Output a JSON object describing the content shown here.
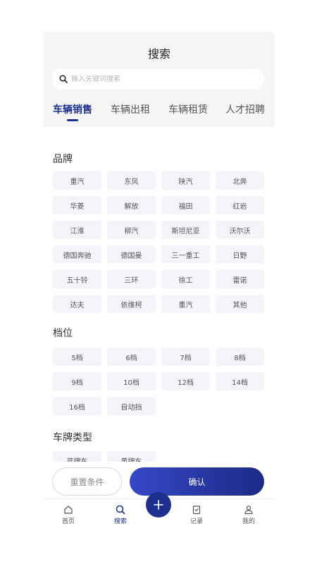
{
  "header": {
    "title": "搜索"
  },
  "search": {
    "placeholder": "输入关键词搜索"
  },
  "tabs": [
    {
      "label": "车辆销售",
      "active": true
    },
    {
      "label": "车辆出租",
      "active": false
    },
    {
      "label": "车辆租赁",
      "active": false
    },
    {
      "label": "人才招聘",
      "active": false
    }
  ],
  "sections": {
    "brand": {
      "title": "品牌",
      "options": [
        "重汽",
        "东风",
        "陕汽",
        "北奔",
        "华菱",
        "解放",
        "福田",
        "红岩",
        "江淮",
        "柳汽",
        "斯坦尼亚",
        "沃尔沃",
        "德国奔驰",
        "德国曼",
        "三一重工",
        "日野",
        "五十铃",
        "三环",
        "徐工",
        "雷诺",
        "达夫",
        "依维柯",
        "重汽",
        "其他"
      ]
    },
    "gear": {
      "title": "档位",
      "options": [
        "5档",
        "6档",
        "7档",
        "8档",
        "9档",
        "10档",
        "12档",
        "14档",
        "16档",
        "自动挡"
      ]
    },
    "plate": {
      "title": "车牌类型",
      "options": [
        "蓝牌车",
        "黄牌车"
      ]
    }
  },
  "actions": {
    "reset_label": "重置条件",
    "confirm_label": "确认"
  },
  "nav": [
    {
      "label": "首页",
      "icon": "home-icon"
    },
    {
      "label": "搜索",
      "icon": "search-icon",
      "active": true
    },
    {
      "label": "记录",
      "icon": "record-icon"
    },
    {
      "label": "我的",
      "icon": "user-icon"
    }
  ],
  "colors": {
    "accent": "#1d2f8c",
    "chip_bg": "#f3f5fa",
    "header_bg": "#f6f6f6"
  }
}
